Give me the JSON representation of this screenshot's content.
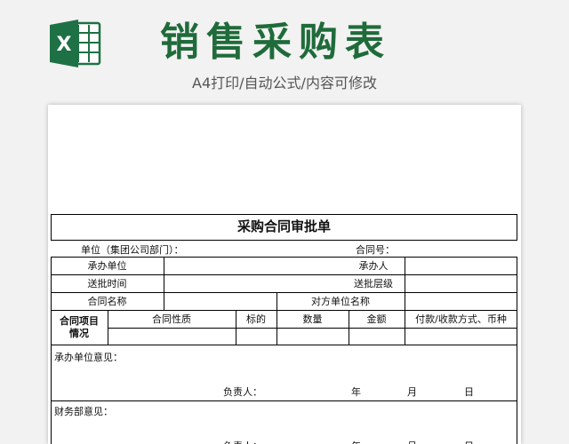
{
  "header": {
    "title": "销售采购表",
    "subtitle": "A4打印/自动公式/内容可修改",
    "logo_letter": "X"
  },
  "colors": {
    "brand_green": "#1f6b3a",
    "excel_green": "#1e7145"
  },
  "icons": {
    "logo": "excel-icon"
  },
  "form": {
    "title": "采购合同审批单",
    "unit_label": "单位（集团公司部门）：",
    "contract_no_label": "合同号：",
    "undertake_unit": "承办单位",
    "undertaker": "承办人",
    "submit_time": "送批时间",
    "submit_level": "送批层级",
    "contract_name": "合同名称",
    "counterparty": "对方单位名称",
    "project_label_1": "合同项目",
    "project_label_2": "情况",
    "columns": [
      "合同性质",
      "标的",
      "数量",
      "金额",
      "付款/收款方式、币种"
    ],
    "undertake_opinion": "承办单位意见：",
    "finance_opinion": "财务部意见：",
    "responsible": "负责人：",
    "year": "年",
    "month": "月",
    "day": "日"
  }
}
